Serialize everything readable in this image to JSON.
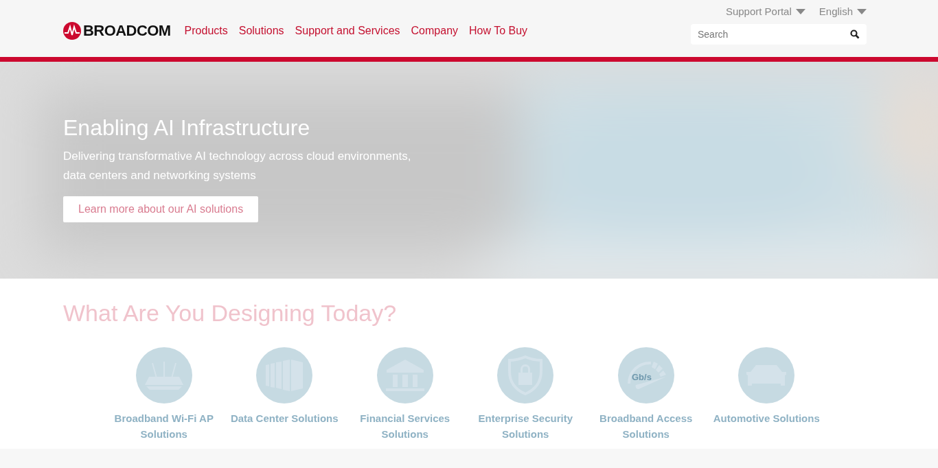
{
  "header": {
    "logo": "BROADCOM",
    "nav": [
      "Products",
      "Solutions",
      "Support and Services",
      "Company",
      "How To Buy"
    ],
    "utility": [
      "Support Portal",
      "English"
    ],
    "search": {
      "placeholder": "Search"
    }
  },
  "hero": {
    "title": "Enabling AI Infrastructure",
    "subtitle": "Delivering transformative AI technology across cloud environments, data centers and networking systems",
    "button": "Learn more about our AI solutions"
  },
  "designing": {
    "heading": "What Are You Designing Today?",
    "items": [
      {
        "kind": "router",
        "label": "Broadband Wi-Fi AP Solutions"
      },
      {
        "kind": "datacenter",
        "label": "Data Center Solutions"
      },
      {
        "kind": "bank",
        "label": "Financial Services Solutions"
      },
      {
        "kind": "shield",
        "label": "Enterprise Security Solutions"
      },
      {
        "kind": "gauge",
        "label": "Broadband Access Solutions",
        "icon_label": "Gb/s"
      },
      {
        "kind": "car",
        "label": "Automotive Solutions"
      }
    ]
  }
}
